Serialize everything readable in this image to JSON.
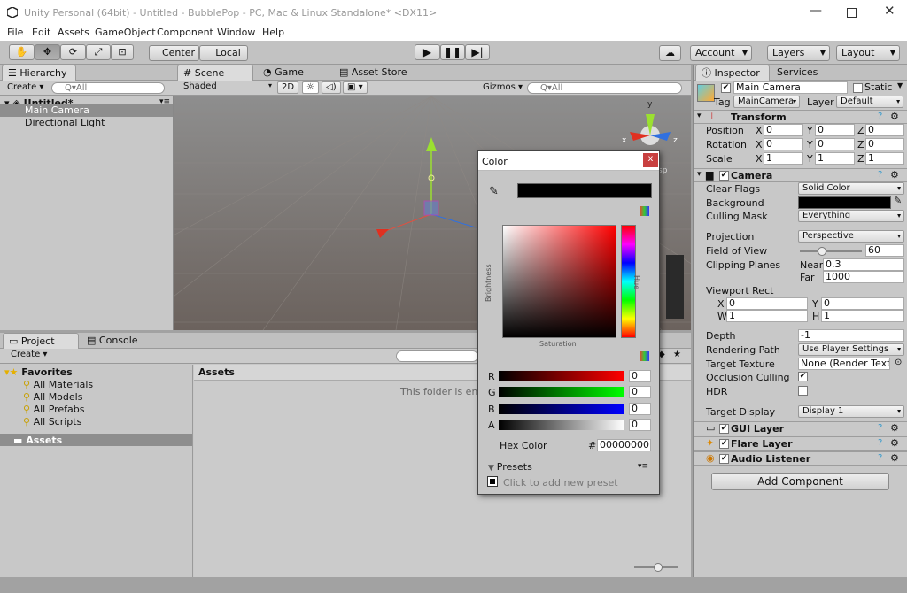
{
  "window": {
    "title": "Unity Personal (64bit) - Untitled - BubblePop - PC, Mac & Linux Standalone* <DX11>"
  },
  "menu": [
    "File",
    "Edit",
    "Assets",
    "GameObject",
    "Component",
    "Window",
    "Help"
  ],
  "toolbar": {
    "center": "Center",
    "local": "Local",
    "account": "Account",
    "layers": "Layers",
    "layout": "Layout"
  },
  "hierarchy": {
    "tab": "Hierarchy",
    "create": "Create",
    "search": "Q▾All",
    "scene": "Untitled*",
    "items": [
      "Main Camera",
      "Directional Light"
    ]
  },
  "scene": {
    "tabs": [
      "Scene",
      "Game",
      "Asset Store"
    ],
    "shading": "Shaded",
    "mode2d": "2D",
    "gizmos": "Gizmos",
    "search": "Q▾All",
    "axis": {
      "x": "x",
      "y": "y",
      "z": "z"
    },
    "persp": "sp"
  },
  "project": {
    "tabs": [
      "Project",
      "Console"
    ],
    "create": "Create",
    "favorites": "Favorites",
    "fav_items": [
      "All Materials",
      "All Models",
      "All Prefabs",
      "All Scripts"
    ],
    "assets": "Assets",
    "assets_header": "Assets",
    "empty": "This folder is emp"
  },
  "inspector": {
    "tabs": [
      "Inspector",
      "Services"
    ],
    "name": "Main Camera",
    "static": "Static",
    "tag_label": "Tag",
    "tag": "MainCamera",
    "layer_label": "Layer",
    "layer": "Default",
    "transform": {
      "title": "Transform",
      "rows": [
        {
          "label": "Position",
          "x": "0",
          "y": "0",
          "z": "0"
        },
        {
          "label": "Rotation",
          "x": "0",
          "y": "0",
          "z": "0"
        },
        {
          "label": "Scale",
          "x": "1",
          "y": "1",
          "z": "1"
        }
      ]
    },
    "camera": {
      "title": "Camera",
      "clear_flags_label": "Clear Flags",
      "clear_flags": "Solid Color",
      "background_label": "Background",
      "background_color": "#000000",
      "culling_label": "Culling Mask",
      "culling": "Everything",
      "projection_label": "Projection",
      "projection": "Perspective",
      "fov_label": "Field of View",
      "fov": "60",
      "fov_fraction": 0.33,
      "clipping_label": "Clipping Planes",
      "near_label": "Near",
      "near": "0.3",
      "far_label": "Far",
      "far": "1000",
      "viewport_label": "Viewport Rect",
      "vx": "0",
      "vy": "0",
      "vw": "1",
      "vh": "1",
      "depth_label": "Depth",
      "depth": "-1",
      "render_path_label": "Rendering Path",
      "render_path": "Use Player Settings",
      "target_texture_label": "Target Texture",
      "target_texture": "None (Render Textu",
      "occlusion_label": "Occlusion Culling",
      "hdr_label": "HDR",
      "target_display_label": "Target Display",
      "target_display": "Display 1"
    },
    "components": [
      "GUI Layer",
      "Flare Layer",
      "Audio Listener"
    ],
    "add_component": "Add Component"
  },
  "color_picker": {
    "title": "Color",
    "close": "x",
    "brightness": "Brightness",
    "hue": "Hue",
    "saturation": "Saturation",
    "channels": [
      {
        "label": "R",
        "value": "0"
      },
      {
        "label": "G",
        "value": "0"
      },
      {
        "label": "B",
        "value": "0"
      },
      {
        "label": "A",
        "value": "0"
      }
    ],
    "hex_label": "Hex Color",
    "hex_hash": "#",
    "hex": "00000000",
    "presets": "Presets",
    "add_preset": "Click to add new preset",
    "accent": "#e04040"
  }
}
